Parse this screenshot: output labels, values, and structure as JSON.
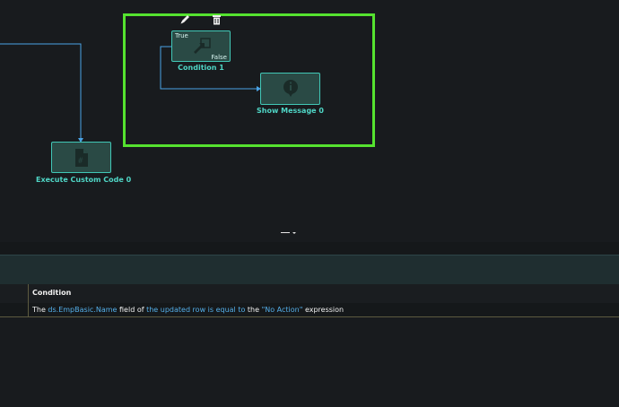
{
  "nodes": {
    "condition": {
      "label": "Condition 1",
      "true_label": "True",
      "false_label": "False"
    },
    "show_message": {
      "label": "Show Message 0"
    },
    "execute_code": {
      "label": "Execute Custom Code 0"
    }
  },
  "toolbar": {
    "edit_icon": "pencil-icon",
    "delete_icon": "trash-icon"
  },
  "grid": {
    "column_header": "Condition",
    "row": {
      "t1": "The ",
      "field": "ds.EmpBasic.Name",
      "t2": " field of ",
      "rowref": "the updated row is equal to",
      "t3": " the ",
      "value": "\"No Action\"",
      "t4": " expression"
    }
  },
  "colors": {
    "node_border": "#41c7b6",
    "selection": "#55e32f",
    "wire": "#4aa3e6",
    "link": "#54aee8"
  }
}
